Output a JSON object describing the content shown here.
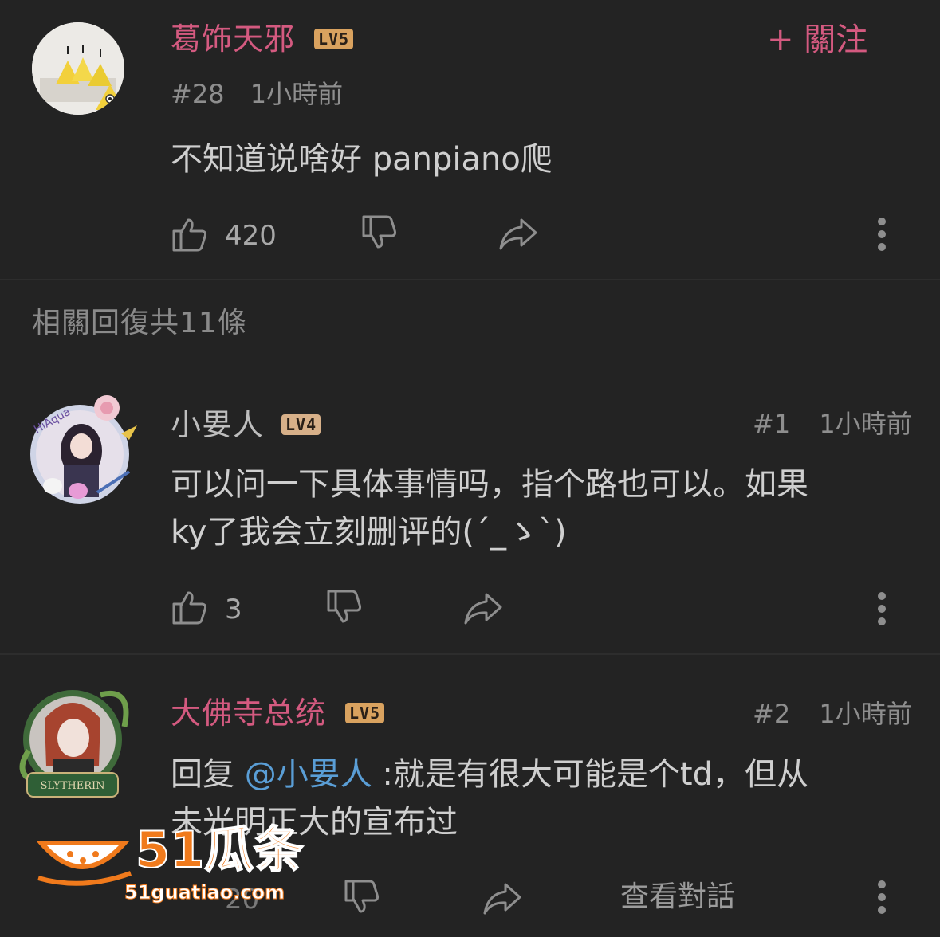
{
  "main_comment": {
    "username": "葛饰天邪",
    "level": "LV5",
    "follow_label": "+ 關注",
    "floor": "#28",
    "time": "1小時前",
    "text": "不知道说啥好 panpiano爬",
    "likes": "420"
  },
  "replies_header": "相關回復共11條",
  "replies": [
    {
      "username": "小㚻人",
      "level": "LV4",
      "floor": "#1",
      "time": "1小時前",
      "text_line1": "可以问一下具体事情吗，指个路也可以。如果",
      "text_line2": "ky了我会立刻删评的(´_ゝ`)",
      "likes": "3"
    },
    {
      "username": "大佛寺总统",
      "level": "LV5",
      "floor": "#2",
      "time": "1小時前",
      "reply_prefix": "回复 ",
      "mention": "@小㚻人",
      "text_line1_rest": " :就是有很大可能是个td，但从",
      "text_line2": "未光明正大的宣布过",
      "likes": "20",
      "view_conversation": "查看對話"
    }
  ],
  "watermark": {
    "brand": "51瓜条",
    "url": "51guatiao.com"
  },
  "colors": {
    "background": "#232323",
    "accent_pink": "#d45a80",
    "mention_blue": "#5a9ed6",
    "level_badge": "#d9a25f",
    "watermark_orange": "#f07a1c"
  },
  "icons": [
    "thumbs-up-icon",
    "thumbs-down-icon",
    "share-icon",
    "more-icon"
  ]
}
